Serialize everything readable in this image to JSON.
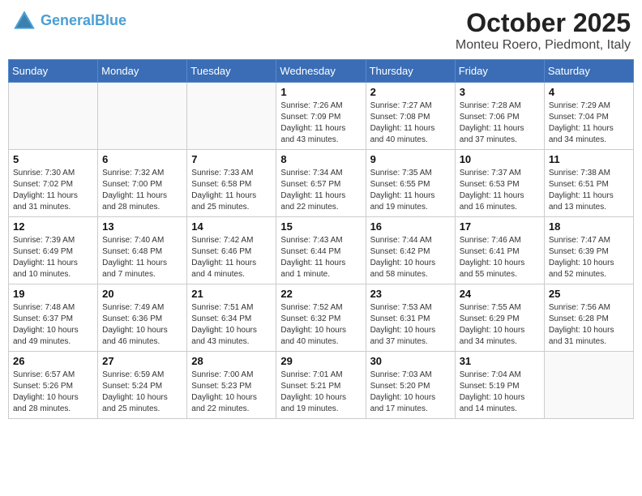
{
  "header": {
    "logo_line1": "General",
    "logo_line2": "Blue",
    "month": "October 2025",
    "location": "Monteu Roero, Piedmont, Italy"
  },
  "weekdays": [
    "Sunday",
    "Monday",
    "Tuesday",
    "Wednesday",
    "Thursday",
    "Friday",
    "Saturday"
  ],
  "weeks": [
    [
      {
        "day": "",
        "info": ""
      },
      {
        "day": "",
        "info": ""
      },
      {
        "day": "",
        "info": ""
      },
      {
        "day": "1",
        "info": "Sunrise: 7:26 AM\nSunset: 7:09 PM\nDaylight: 11 hours\nand 43 minutes."
      },
      {
        "day": "2",
        "info": "Sunrise: 7:27 AM\nSunset: 7:08 PM\nDaylight: 11 hours\nand 40 minutes."
      },
      {
        "day": "3",
        "info": "Sunrise: 7:28 AM\nSunset: 7:06 PM\nDaylight: 11 hours\nand 37 minutes."
      },
      {
        "day": "4",
        "info": "Sunrise: 7:29 AM\nSunset: 7:04 PM\nDaylight: 11 hours\nand 34 minutes."
      }
    ],
    [
      {
        "day": "5",
        "info": "Sunrise: 7:30 AM\nSunset: 7:02 PM\nDaylight: 11 hours\nand 31 minutes."
      },
      {
        "day": "6",
        "info": "Sunrise: 7:32 AM\nSunset: 7:00 PM\nDaylight: 11 hours\nand 28 minutes."
      },
      {
        "day": "7",
        "info": "Sunrise: 7:33 AM\nSunset: 6:58 PM\nDaylight: 11 hours\nand 25 minutes."
      },
      {
        "day": "8",
        "info": "Sunrise: 7:34 AM\nSunset: 6:57 PM\nDaylight: 11 hours\nand 22 minutes."
      },
      {
        "day": "9",
        "info": "Sunrise: 7:35 AM\nSunset: 6:55 PM\nDaylight: 11 hours\nand 19 minutes."
      },
      {
        "day": "10",
        "info": "Sunrise: 7:37 AM\nSunset: 6:53 PM\nDaylight: 11 hours\nand 16 minutes."
      },
      {
        "day": "11",
        "info": "Sunrise: 7:38 AM\nSunset: 6:51 PM\nDaylight: 11 hours\nand 13 minutes."
      }
    ],
    [
      {
        "day": "12",
        "info": "Sunrise: 7:39 AM\nSunset: 6:49 PM\nDaylight: 11 hours\nand 10 minutes."
      },
      {
        "day": "13",
        "info": "Sunrise: 7:40 AM\nSunset: 6:48 PM\nDaylight: 11 hours\nand 7 minutes."
      },
      {
        "day": "14",
        "info": "Sunrise: 7:42 AM\nSunset: 6:46 PM\nDaylight: 11 hours\nand 4 minutes."
      },
      {
        "day": "15",
        "info": "Sunrise: 7:43 AM\nSunset: 6:44 PM\nDaylight: 11 hours\nand 1 minute."
      },
      {
        "day": "16",
        "info": "Sunrise: 7:44 AM\nSunset: 6:42 PM\nDaylight: 10 hours\nand 58 minutes."
      },
      {
        "day": "17",
        "info": "Sunrise: 7:46 AM\nSunset: 6:41 PM\nDaylight: 10 hours\nand 55 minutes."
      },
      {
        "day": "18",
        "info": "Sunrise: 7:47 AM\nSunset: 6:39 PM\nDaylight: 10 hours\nand 52 minutes."
      }
    ],
    [
      {
        "day": "19",
        "info": "Sunrise: 7:48 AM\nSunset: 6:37 PM\nDaylight: 10 hours\nand 49 minutes."
      },
      {
        "day": "20",
        "info": "Sunrise: 7:49 AM\nSunset: 6:36 PM\nDaylight: 10 hours\nand 46 minutes."
      },
      {
        "day": "21",
        "info": "Sunrise: 7:51 AM\nSunset: 6:34 PM\nDaylight: 10 hours\nand 43 minutes."
      },
      {
        "day": "22",
        "info": "Sunrise: 7:52 AM\nSunset: 6:32 PM\nDaylight: 10 hours\nand 40 minutes."
      },
      {
        "day": "23",
        "info": "Sunrise: 7:53 AM\nSunset: 6:31 PM\nDaylight: 10 hours\nand 37 minutes."
      },
      {
        "day": "24",
        "info": "Sunrise: 7:55 AM\nSunset: 6:29 PM\nDaylight: 10 hours\nand 34 minutes."
      },
      {
        "day": "25",
        "info": "Sunrise: 7:56 AM\nSunset: 6:28 PM\nDaylight: 10 hours\nand 31 minutes."
      }
    ],
    [
      {
        "day": "26",
        "info": "Sunrise: 6:57 AM\nSunset: 5:26 PM\nDaylight: 10 hours\nand 28 minutes."
      },
      {
        "day": "27",
        "info": "Sunrise: 6:59 AM\nSunset: 5:24 PM\nDaylight: 10 hours\nand 25 minutes."
      },
      {
        "day": "28",
        "info": "Sunrise: 7:00 AM\nSunset: 5:23 PM\nDaylight: 10 hours\nand 22 minutes."
      },
      {
        "day": "29",
        "info": "Sunrise: 7:01 AM\nSunset: 5:21 PM\nDaylight: 10 hours\nand 19 minutes."
      },
      {
        "day": "30",
        "info": "Sunrise: 7:03 AM\nSunset: 5:20 PM\nDaylight: 10 hours\nand 17 minutes."
      },
      {
        "day": "31",
        "info": "Sunrise: 7:04 AM\nSunset: 5:19 PM\nDaylight: 10 hours\nand 14 minutes."
      },
      {
        "day": "",
        "info": ""
      }
    ]
  ]
}
